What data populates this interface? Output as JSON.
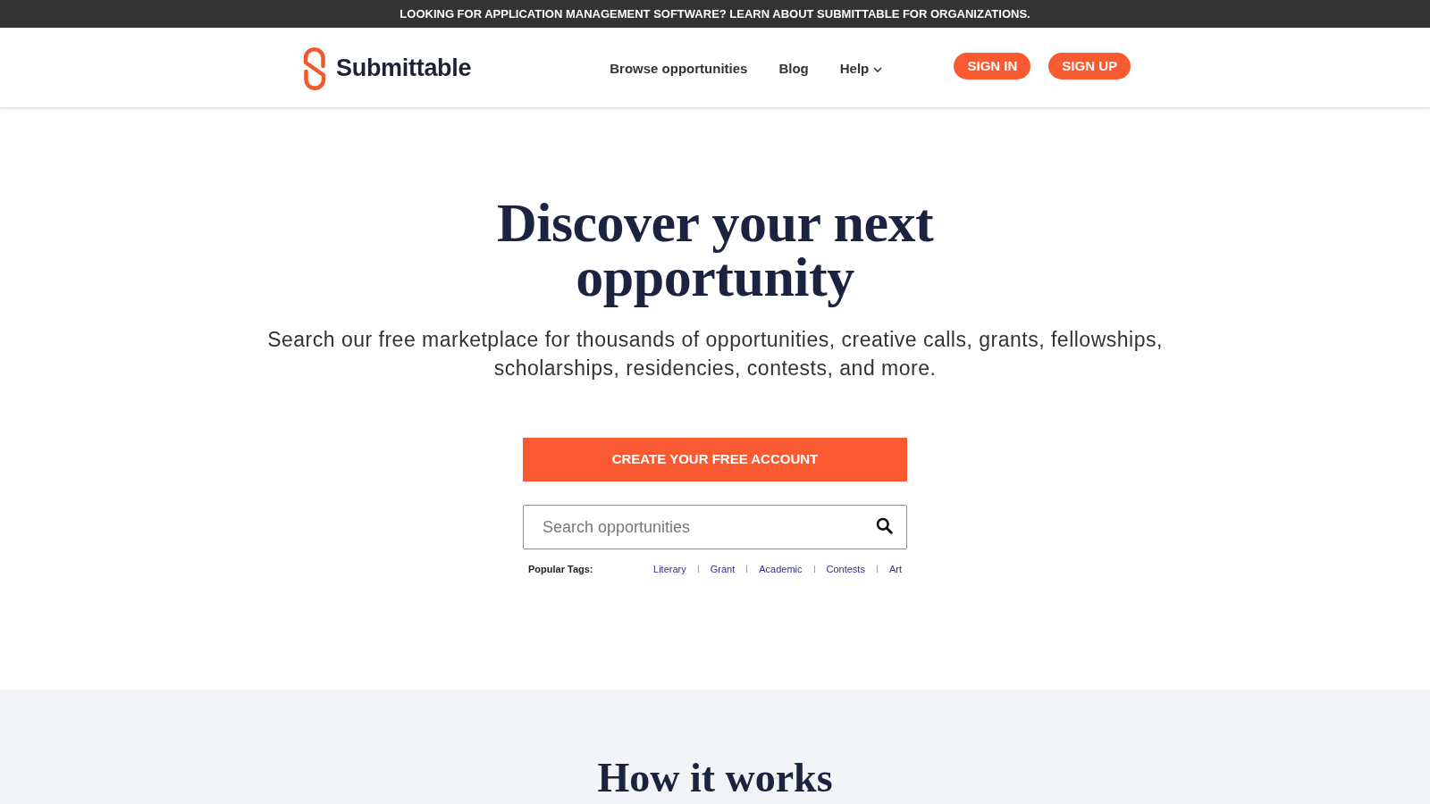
{
  "announcement_bar": {
    "text": "LOOKING FOR APPLICATION MANAGEMENT SOFTWARE? LEARN ABOUT SUBMITTABLE FOR ORGANIZATIONS."
  },
  "header": {
    "logo_text": "Submittable",
    "nav": [
      {
        "label": "Browse opportunities",
        "has_menu": false
      },
      {
        "label": "Blog",
        "has_menu": false
      },
      {
        "label": "Help",
        "has_menu": true
      }
    ],
    "buttons": [
      "SIGN IN",
      "SIGN UP"
    ]
  },
  "hero": {
    "title": "Discover your next opportunity",
    "subtitle": "Search our free marketplace for thousands of opportunities, creative calls, grants, fellowships, scholarships, residencies, contests, and more.",
    "cta": "CREATE YOUR FREE ACCOUNT",
    "search": {
      "placeholder": "Search opportunities"
    },
    "popular_tags": {
      "label": "Popular Tags:",
      "tags": [
        "Literary",
        "Grant",
        "Academic",
        "Contests",
        "Art"
      ]
    }
  },
  "how_it_works": {
    "title": "How it works"
  }
}
